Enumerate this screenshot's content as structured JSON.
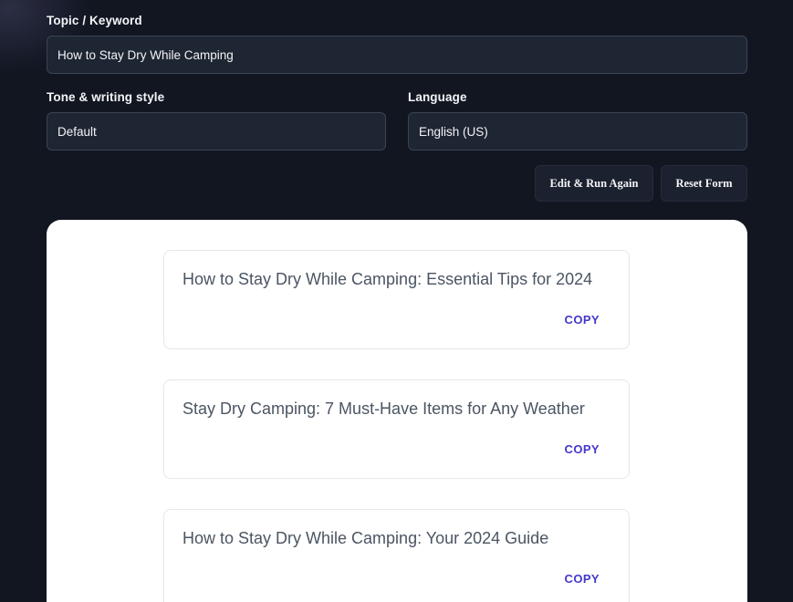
{
  "form": {
    "topic_label": "Topic / Keyword",
    "topic_value": "How to Stay Dry While Camping",
    "tone_label": "Tone & writing style",
    "tone_value": "Default",
    "language_label": "Language",
    "language_value": "English (US)"
  },
  "actions": {
    "edit_run_label": "Edit & Run Again",
    "reset_label": "Reset Form"
  },
  "results": [
    {
      "text": "How to Stay Dry While Camping: Essential Tips for 2024",
      "copy_label": "COPY"
    },
    {
      "text": "Stay Dry Camping: 7 Must-Have Items for Any Weather",
      "copy_label": "COPY"
    },
    {
      "text": "How to Stay Dry While Camping: Your 2024 Guide",
      "copy_label": "COPY"
    }
  ],
  "colors": {
    "background": "#111621",
    "input_background": "#1e2533",
    "copy_accent": "#4338ca"
  }
}
